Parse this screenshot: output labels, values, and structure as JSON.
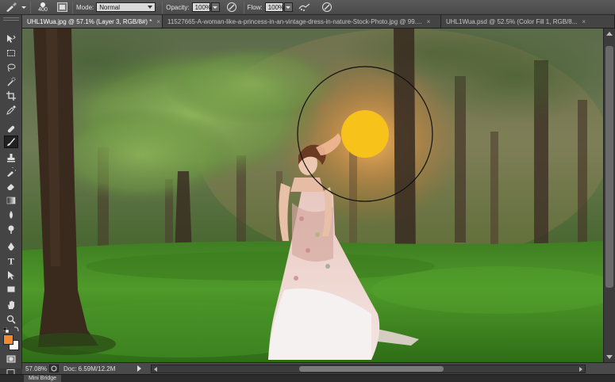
{
  "options_bar": {
    "brush_size": "400",
    "mode_label": "Mode:",
    "mode_value": "Normal",
    "opacity_label": "Opacity:",
    "opacity_value": "100%",
    "flow_label": "Flow:",
    "flow_value": "100%"
  },
  "tabs": [
    {
      "label": "UHL1Wua.jpg @ 57.1% (Layer 3, RGB/8#) *",
      "active": true
    },
    {
      "label": "11527665-A-woman-like-a-princess-in-an-vintage-dress-in-nature-Stock-Photo.jpg @ 99....",
      "active": false
    },
    {
      "label": "UHL1Wua.psd @ 52.5% (Color Fill 1, RGB/8...",
      "active": false
    }
  ],
  "status_bar": {
    "zoom": "57.08%",
    "doc_info": "Doc: 6.59M/12.2M"
  },
  "bottom_panel": {
    "tab_label": "Mini Bridge"
  },
  "colors": {
    "foreground": "#f08a2c",
    "background": "#ffffff",
    "sun_fill": "#f7c21a"
  },
  "tools": [
    "move-icon",
    "marquee-icon",
    "lasso-icon",
    "quick-select-icon",
    "crop-icon",
    "eyedropper-icon",
    "healing-icon",
    "brush-icon",
    "stamp-icon",
    "history-brush-icon",
    "eraser-icon",
    "gradient-icon",
    "blur-icon",
    "dodge-icon",
    "pen-icon",
    "type-icon",
    "path-select-icon",
    "shape-icon",
    "hand-icon",
    "zoom-icon"
  ]
}
